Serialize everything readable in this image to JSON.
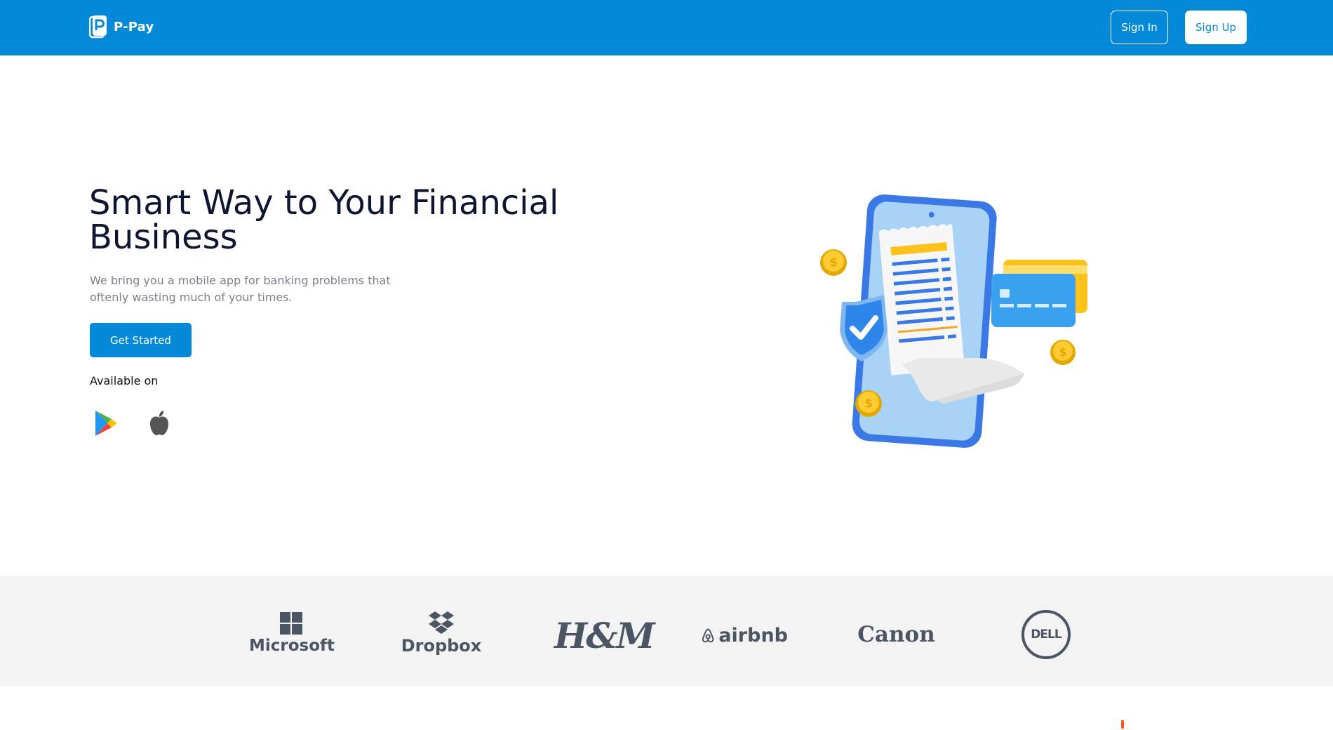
{
  "header": {
    "logo_text": "P-Pay",
    "sign_in_label": "Sign In",
    "sign_up_label": "Sign Up"
  },
  "hero": {
    "title": "Smart Way to Your Financial Business",
    "subtitle": "We bring you a mobile app for banking problems that oftenly wasting much of your times.",
    "cta_label": "Get Started",
    "available_label": "Available on"
  },
  "partners": {
    "microsoft": "Microsoft",
    "dropbox": "Dropbox",
    "hm": "H&M",
    "airbnb": "airbnb",
    "canon": "Canon",
    "dell": "DELL"
  },
  "colors": {
    "brand_blue": "#0489d9",
    "partner_band": "#f3f3f3",
    "logo_gray": "#4b5563"
  }
}
